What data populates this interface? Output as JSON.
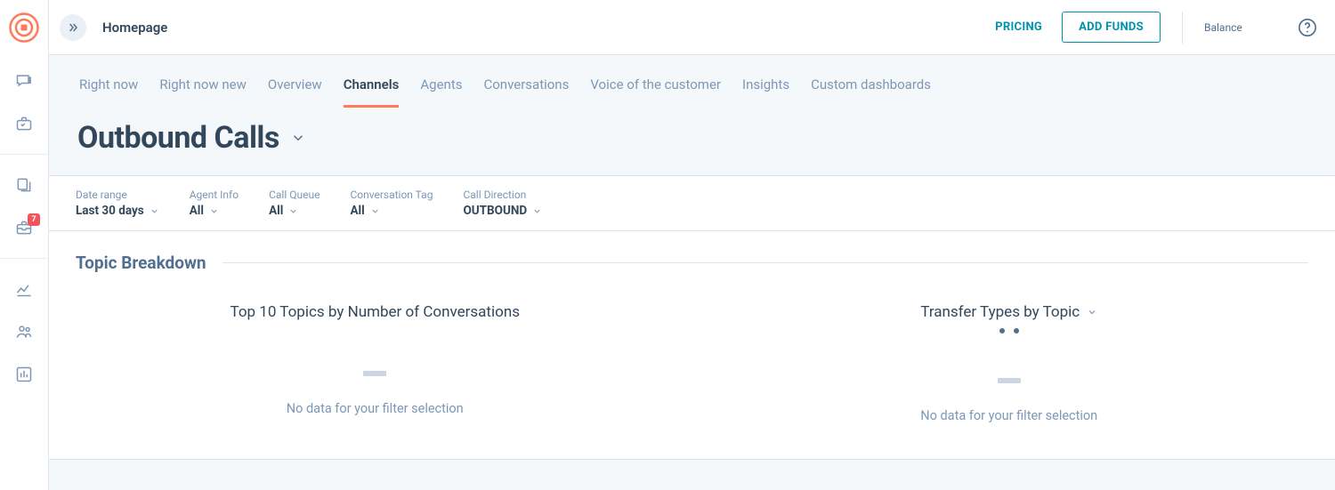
{
  "rail": {
    "badge_count": "7"
  },
  "header": {
    "breadcrumb": "Homepage",
    "pricing_label": "PRICING",
    "add_funds_label": "ADD FUNDS",
    "balance_label": "Balance"
  },
  "tabs": [
    {
      "label": "Right now",
      "active": false
    },
    {
      "label": "Right now new",
      "active": false
    },
    {
      "label": "Overview",
      "active": false
    },
    {
      "label": "Channels",
      "active": true
    },
    {
      "label": "Agents",
      "active": false
    },
    {
      "label": "Conversations",
      "active": false
    },
    {
      "label": "Voice of the customer",
      "active": false
    },
    {
      "label": "Insights",
      "active": false
    },
    {
      "label": "Custom dashboards",
      "active": false
    }
  ],
  "page_title": "Outbound Calls",
  "filters": [
    {
      "label": "Date range",
      "value": "Last 30 days"
    },
    {
      "label": "Agent Info",
      "value": "All"
    },
    {
      "label": "Call Queue",
      "value": "All"
    },
    {
      "label": "Conversation Tag",
      "value": "All"
    },
    {
      "label": "Call Direction",
      "value": "OUTBOUND"
    }
  ],
  "section": {
    "title": "Topic Breakdown",
    "cards": [
      {
        "title": "Top 10 Topics by Number of Conversations",
        "has_dropdown": false,
        "no_data": "No data for your filter selection"
      },
      {
        "title": "Transfer Types by Topic",
        "has_dropdown": true,
        "no_data": "No data for your filter selection"
      }
    ]
  }
}
